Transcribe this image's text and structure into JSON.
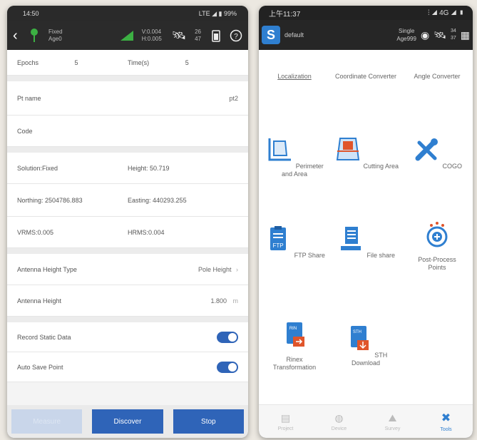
{
  "phone1": {
    "status": {
      "time": "14:50",
      "right": "LTE ◢ ▮ 99%"
    },
    "header": {
      "fix_top": "Fixed",
      "fix_bottom": "Age0",
      "val_top": "V:0.004",
      "val_bottom": "H:0.005",
      "sat_top": "26",
      "sat_bottom": "47"
    },
    "epochs": {
      "label": "Epochs",
      "value": "5"
    },
    "time": {
      "label": "Time(s)",
      "value": "5"
    },
    "pt_name": {
      "label": "Pt name",
      "value": "pt2"
    },
    "code": {
      "label": "Code"
    },
    "solution": "Solution:Fixed",
    "height": "Height: 50.719",
    "northing": "Northing: 2504786.883",
    "easting": "Easting: 440293.255",
    "vrms": "VRMS:0.005",
    "hrms": "HRMS:0.004",
    "antenna_type": {
      "label": "Antenna Height Type",
      "value": "Pole Height"
    },
    "antenna_height": {
      "label": "Antenna Height",
      "value": "1.800",
      "unit": "m"
    },
    "record_static": {
      "label": "Record Static Data",
      "on": true
    },
    "auto_save": {
      "label": "Auto Save Point",
      "on": true
    },
    "buttons": {
      "disabled": "Measure",
      "discover": "Discover",
      "stop": "Stop"
    }
  },
  "phone2": {
    "status": {
      "time": "上午11:37",
      "right": "⫶ ◢ 4G ◢ ▮"
    },
    "header": {
      "project": "default",
      "single": "Single",
      "age": "Age999",
      "sat_top": "34",
      "sat_bottom": "37"
    },
    "tools": [
      {
        "label": "Localization"
      },
      {
        "label": "Coordinate Converter"
      },
      {
        "label": "Angle Converter"
      },
      {
        "label": "Perimeter and Area"
      },
      {
        "label": "Cutting Area"
      },
      {
        "label": "COGO"
      },
      {
        "label": "FTP Share"
      },
      {
        "label": "File share"
      },
      {
        "label": "Post-Process Points"
      },
      {
        "label": "Rinex Transformation"
      },
      {
        "label": "STH Download"
      }
    ],
    "nav": [
      {
        "label": "Project"
      },
      {
        "label": "Device"
      },
      {
        "label": "Survey"
      },
      {
        "label": "Tools"
      }
    ],
    "colors": {
      "accent": "#2f7fd0",
      "button": "#2f64b8",
      "orange": "#e0552b"
    }
  }
}
